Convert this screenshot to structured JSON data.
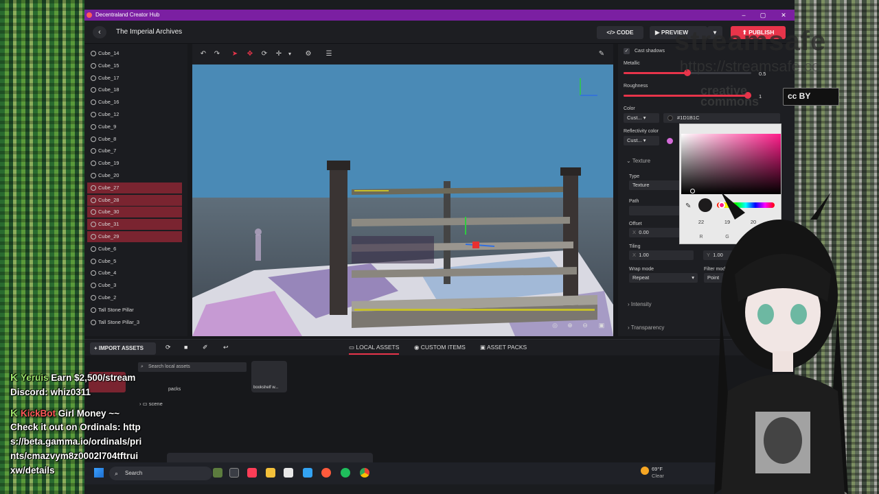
{
  "window": {
    "title": "Decentraland Creator Hub",
    "controls": [
      "–",
      "▢",
      "✕"
    ]
  },
  "header": {
    "back": "‹",
    "scene_title": "The Imperial Archives",
    "code_label": "CODE",
    "preview_label": "PREVIEW",
    "publish_label": "PUBLISH"
  },
  "tree": {
    "items": [
      {
        "label": "Cube_14",
        "selected": false
      },
      {
        "label": "Cube_15",
        "selected": false
      },
      {
        "label": "Cube_17",
        "selected": false
      },
      {
        "label": "Cube_18",
        "selected": false
      },
      {
        "label": "Cube_16",
        "selected": false
      },
      {
        "label": "Cube_12",
        "selected": false
      },
      {
        "label": "Cube_9",
        "selected": false
      },
      {
        "label": "Cube_8",
        "selected": false
      },
      {
        "label": "Cube_7",
        "selected": false
      },
      {
        "label": "Cube_19",
        "selected": false
      },
      {
        "label": "Cube_20",
        "selected": false
      },
      {
        "label": "Cube_27",
        "selected": true
      },
      {
        "label": "Cube_28",
        "selected": true
      },
      {
        "label": "Cube_30",
        "selected": true
      },
      {
        "label": "Cube_31",
        "selected": true
      },
      {
        "label": "Cube_29",
        "selected": true
      },
      {
        "label": "Cube_6",
        "selected": false
      },
      {
        "label": "Cube_5",
        "selected": false
      },
      {
        "label": "Cube_4",
        "selected": false
      },
      {
        "label": "Cube_3",
        "selected": false
      },
      {
        "label": "Cube_2",
        "selected": false
      },
      {
        "label": "Tall Stone Pillar",
        "selected": false
      },
      {
        "label": "Tall Stone Pillar_3",
        "selected": false
      }
    ]
  },
  "props": {
    "cast_shadows": "Cast shadows",
    "metallic_label": "Metallic",
    "metallic_value": "0.5",
    "metallic_level": 0.5,
    "roughness_label": "Roughness",
    "roughness_value": "1",
    "roughness_level": 1,
    "color_label": "Color",
    "color_mode": "Cust...",
    "color_hex": "#1D1B1C",
    "reflectivity_label": "Reflectivity color",
    "reflectivity_mode": "Cust...",
    "texture_section": "Texture",
    "type_label": "Type",
    "type_value": "Texture",
    "path_label": "Path",
    "offset_label": "Offset",
    "offset_x_axis": "X",
    "offset_x": "0.00",
    "tiling_label": "Tiling",
    "tiling_x_axis": "X",
    "tiling_x": "1.00",
    "tiling_y_axis": "Y",
    "tiling_y": "1.00",
    "wrap_label": "Wrap mode",
    "wrap_value": "Repeat",
    "filter_label": "Filter mode",
    "filter_value": "Point",
    "intensity_section": "Intensity",
    "transparency_section": "Transparency"
  },
  "picker": {
    "r": "22",
    "g": "19",
    "b": "20",
    "r_label": "R",
    "g_label": "G",
    "b_label": "B",
    "swatch": "#1D1B1C",
    "hue_color": "#FF1C8A"
  },
  "assets": {
    "import_label": "IMPORT ASSETS",
    "tabs": [
      "LOCAL ASSETS",
      "CUSTOM ITEMS",
      "ASSET PACKS"
    ],
    "search_placeholder": "Search local assets",
    "folder_label": "scene",
    "folder_partial": "packs",
    "tile_label": "bookshelf w..."
  },
  "taskbar": {
    "search_placeholder": "Search",
    "weather_temp": "69°F",
    "weather_desc": "Clear"
  },
  "chat": [
    {
      "name": "Yeruis",
      "text": "Earn $2,500/stream"
    },
    {
      "name": "",
      "text": "Discord: whiz0311"
    },
    {
      "name": "KickBot",
      "text": "Girl Money ~~"
    },
    {
      "name": "",
      "text": "Check it out on Ordinals: http"
    },
    {
      "name": "",
      "text": "s://beta.gamma.io/ordinals/pri"
    },
    {
      "name": "",
      "text": "nts/cmazvym8z0002l704tftrui"
    },
    {
      "name": "",
      "text": "xw/details"
    }
  ],
  "watermark": {
    "title": "streamsafe",
    "url": "https://streamsafe.cc",
    "cc_line1": "creative",
    "cc_line2": "commons",
    "badge": "cc  BY"
  },
  "colors": {
    "titlebar": "#7B1FA2",
    "accent": "#E8344A",
    "selected_row": "#7A2430"
  }
}
